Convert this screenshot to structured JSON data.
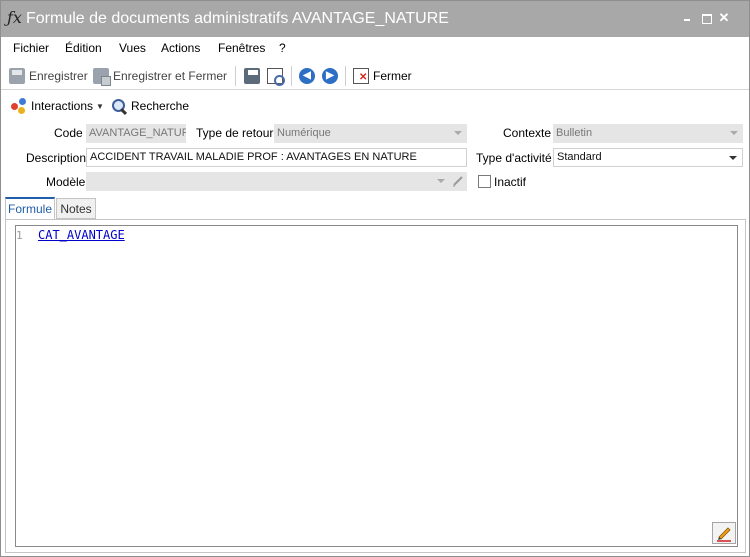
{
  "window": {
    "title": "Formule de documents administratifs AVANTAGE_NATURE",
    "icon_glyph": "ƒx"
  },
  "menu": {
    "items": [
      "Fichier",
      "Édition",
      "Vues",
      "Actions",
      "Fenêtres",
      "?"
    ]
  },
  "toolbar": {
    "save_label": "Enregistrer",
    "save_close_label": "Enregistrer et Fermer",
    "close_label": "Fermer"
  },
  "toolbar2": {
    "interactions_label": "Interactions",
    "search_label": "Recherche"
  },
  "form": {
    "code_label": "Code",
    "code_value": "AVANTAGE_NATUR",
    "return_type_label": "Type de retour",
    "return_type_value": "Numérique",
    "context_label": "Contexte",
    "context_value": "Bulletin",
    "description_label": "Description",
    "description_value": "ACCIDENT TRAVAIL MALADIE PROF : AVANTAGES EN NATURE",
    "activity_type_label": "Type d'activité",
    "activity_type_value": "Standard",
    "model_label": "Modèle",
    "model_value": "",
    "inactive_label": "Inactif",
    "inactive_checked": false
  },
  "tabs": [
    {
      "label": "Formule",
      "active": true
    },
    {
      "label": "Notes",
      "active": false
    }
  ],
  "editor": {
    "line_number": "1",
    "code_text": "CAT_AVANTAGE"
  },
  "colors": {
    "titlebar": "#a8a8a8",
    "accent": "#1f5ea8",
    "code_link": "#0000cc"
  }
}
